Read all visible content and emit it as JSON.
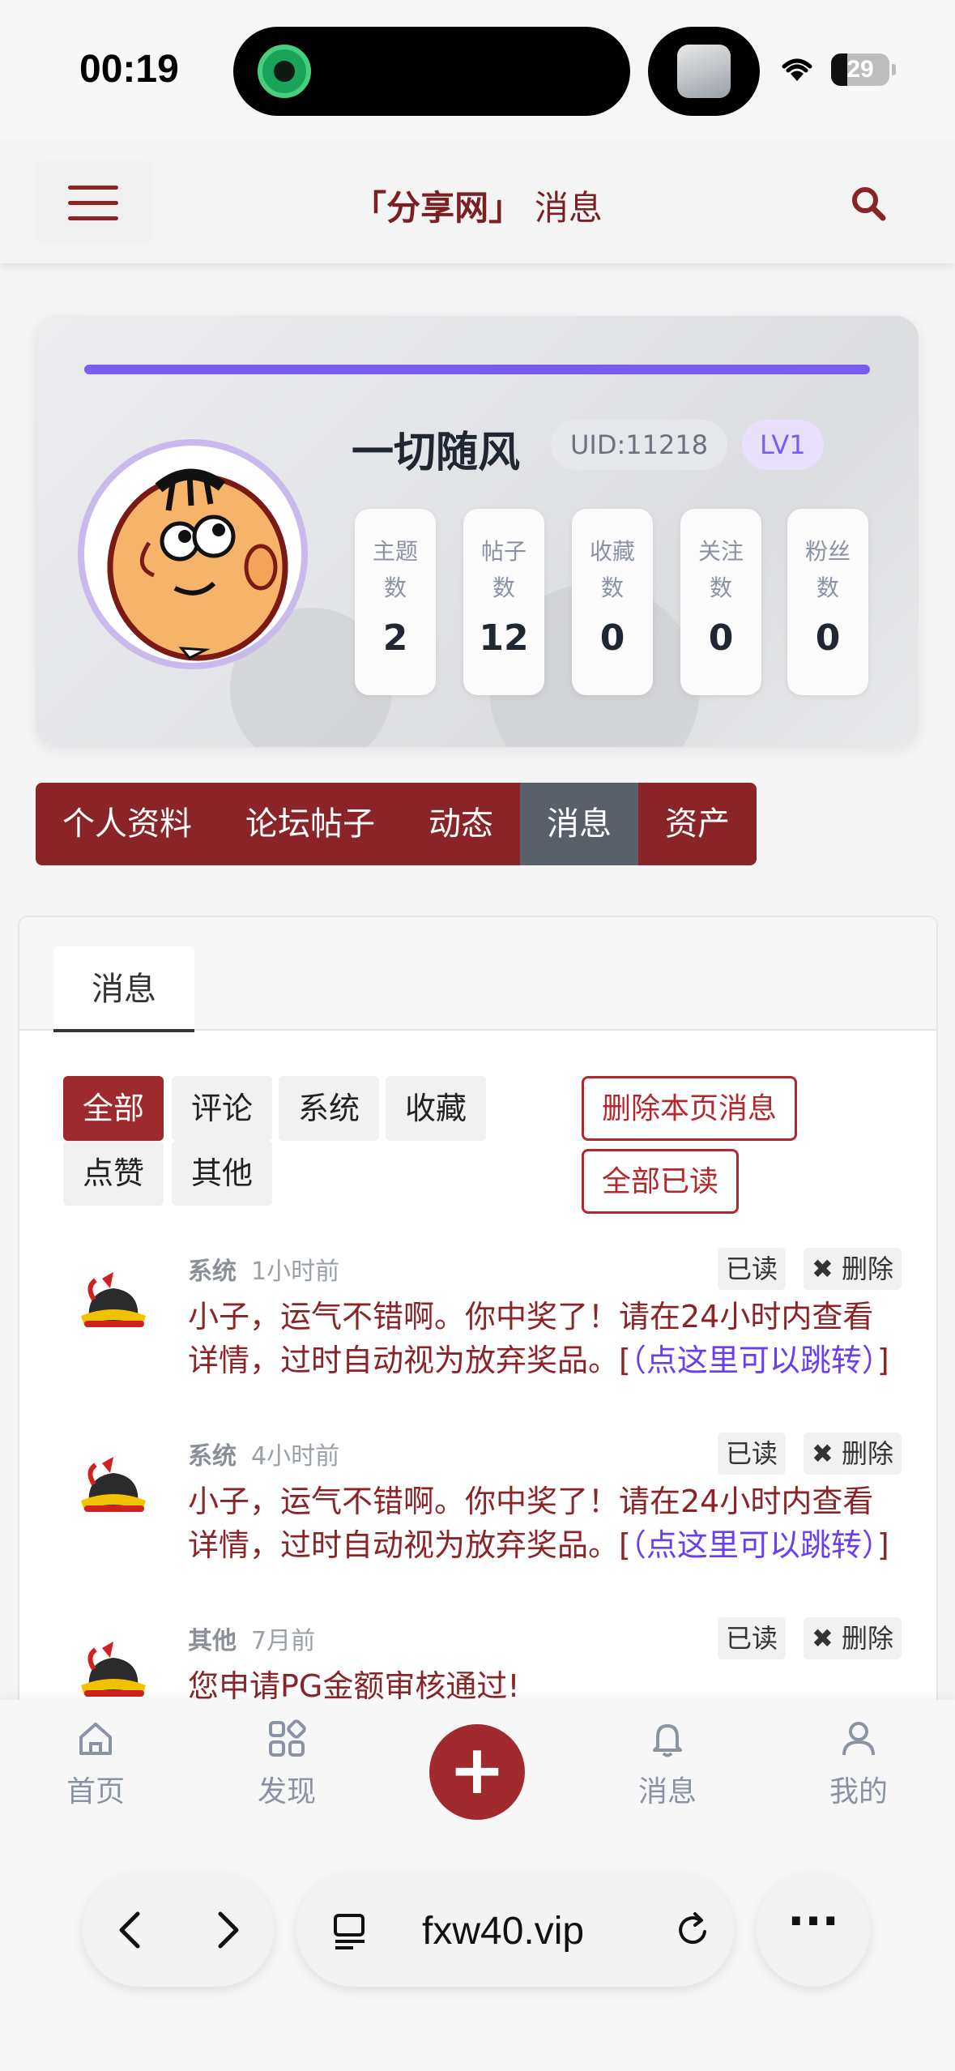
{
  "status_bar": {
    "time": "00:19",
    "battery": "29"
  },
  "header": {
    "brand": "「分享网」",
    "title": "消息"
  },
  "profile": {
    "username": "一切随风",
    "uid": "UID:11218",
    "level": "LV1",
    "stats": [
      {
        "label": "主题数",
        "value": "2"
      },
      {
        "label": "帖子数",
        "value": "12"
      },
      {
        "label": "收藏数",
        "value": "0"
      },
      {
        "label": "关注数",
        "value": "0"
      },
      {
        "label": "粉丝数",
        "value": "0"
      }
    ]
  },
  "tabs": [
    "个人资料",
    "论坛帖子",
    "动态",
    "消息",
    "资产"
  ],
  "panel": {
    "tab": "消息",
    "filters": [
      "全部",
      "评论",
      "系统",
      "收藏",
      "点赞",
      "其他"
    ],
    "actions": {
      "delete_page": "删除本页消息",
      "mark_all_read": "全部已读"
    }
  },
  "messages": [
    {
      "type": "系统",
      "time": "1小时前",
      "read": "已读",
      "delete": "删除",
      "text": "小子，运气不错啊。你中奖了！请在24小时内查看详情，过时自动视为放弃奖品。[",
      "link": "（点这里可以跳转）",
      "tail": "]"
    },
    {
      "type": "系统",
      "time": "4小时前",
      "read": "已读",
      "delete": "删除",
      "text": "小子，运气不错啊。你中奖了！请在24小时内查看详情，过时自动视为放弃奖品。[",
      "link": "（点这里可以跳转）",
      "tail": "]"
    },
    {
      "type": "其他",
      "time": "7月前",
      "read": "已读",
      "delete": "删除",
      "text": "您申请PG金额审核通过!",
      "link": "",
      "tail": ""
    }
  ],
  "bottom_nav": {
    "home": "首页",
    "discover": "发现",
    "messages": "消息",
    "mine": "我的"
  },
  "browser": {
    "url": "fxw40.vip"
  },
  "colors": {
    "brand": "#8a2426",
    "accent": "#7a5cf0",
    "link": "#6a3df0",
    "active_tab": "#59606a"
  }
}
